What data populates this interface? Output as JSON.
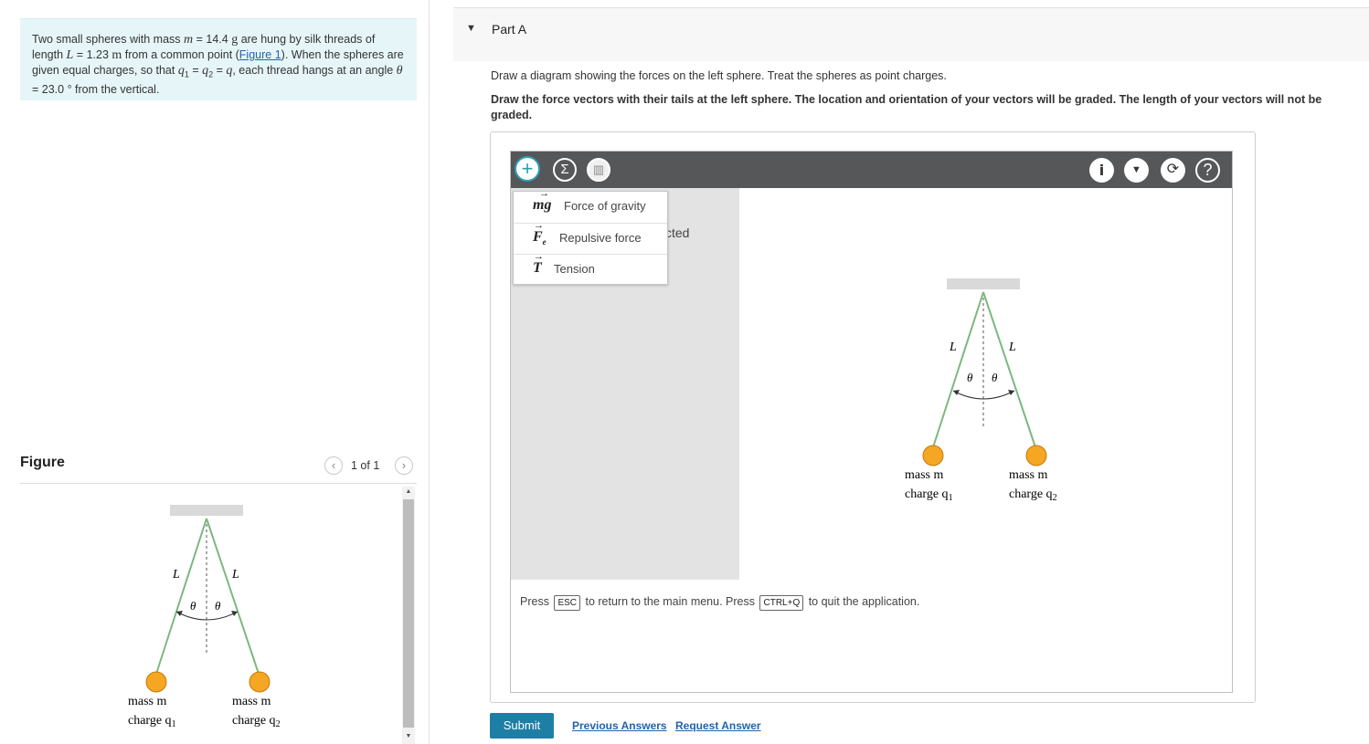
{
  "problem": {
    "s1": "Two small spheres with mass ",
    "m": "m",
    "s2": " = 14.4 ",
    "g": "g",
    "s3": " are hung by silk threads of length ",
    "L": "L",
    "s4": " = 1.23 ",
    "munit": "m",
    "s5": " from a common point (",
    "fig_link": "Figure 1",
    "s6": "). When the spheres are given equal charges, so that ",
    "q1": "q",
    "s7": " = ",
    "q2": "q",
    "s8": " = ",
    "q": "q",
    "s9": ", each thread hangs at an angle ",
    "theta": "θ",
    "s10": " = 23.0 ° from the vertical."
  },
  "figure": {
    "label": "Figure",
    "prev_icon": "chevron-left-icon",
    "next_icon": "chevron-right-icon",
    "counter": "1 of 1",
    "diagram": {
      "L_left": "L",
      "L_right": "L",
      "theta_left": "θ",
      "theta_right": "θ",
      "mass_left": "mass m",
      "charge_left": "charge q",
      "charge_left_sub": "1",
      "mass_right": "mass m",
      "charge_right": "charge q",
      "charge_right_sub": "2",
      "ball_color": "#f5a623",
      "thread_color": "#7db87d"
    }
  },
  "part": {
    "title": "Part A",
    "toggle_icon": "caret-down-icon",
    "instruction1": "Draw a diagram showing the forces on the left sphere. Treat the spheres as point charges.",
    "instruction2": "Draw the force vectors with their tails at the left sphere. The location and orientation of your vectors will be graded. The length of your vectors will not be graded."
  },
  "toolbar": {
    "add": "+",
    "sum": "Σ",
    "del": "🗑",
    "info": "i",
    "chev": "⌄",
    "reset": "⟳",
    "help": "?"
  },
  "side_panel_text": "cted",
  "dropdown": [
    {
      "symbol": "mg⃗",
      "label": "Force of gravity"
    },
    {
      "symbol": "F⃗e",
      "label": "Repulsive force"
    },
    {
      "symbol": "T⃗",
      "label": "Tension"
    }
  ],
  "help": {
    "press": "Press",
    "esc": "ESC",
    "mid": "to return to the main menu. Press",
    "quit_key": "CTRL+Q",
    "end": "to quit the application."
  },
  "actions": {
    "submit": "Submit",
    "previous_answers": "Previous Answers",
    "request_answer": "Request Answer"
  }
}
